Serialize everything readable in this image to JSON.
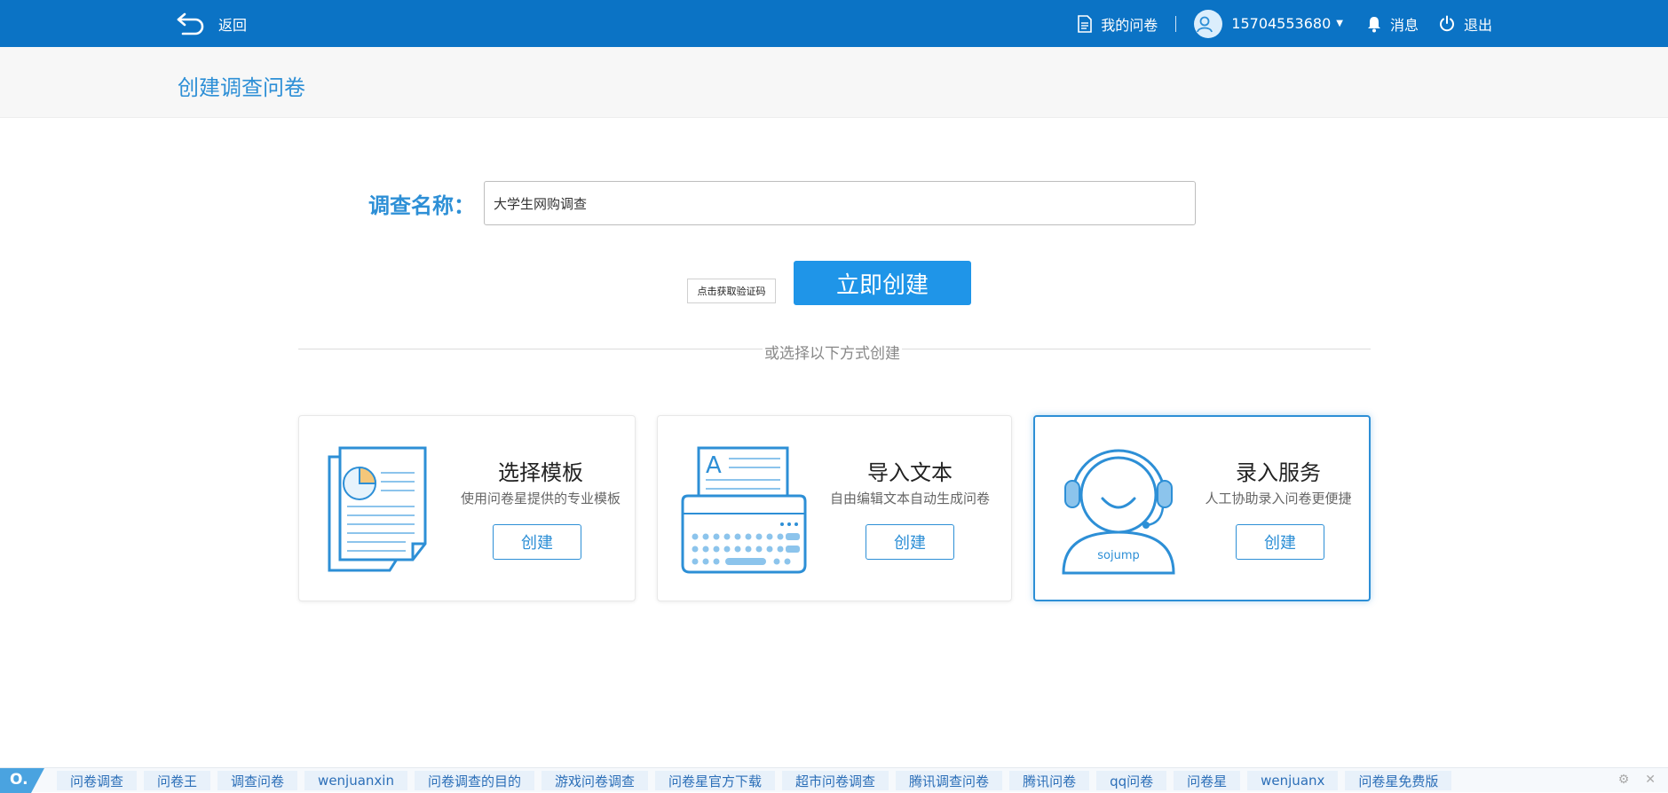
{
  "topbar": {
    "back_label": "返回",
    "my_surveys": "我的问卷",
    "phone": "15704553680",
    "messages": "消息",
    "logout": "退出"
  },
  "page_title": "创建调查问卷",
  "form": {
    "name_label": "调查名称：",
    "name_value": "大学生网购调查",
    "captcha_label": "点击获取验证码",
    "create_now": "立即创建"
  },
  "divider_text": "或选择以下方式创建",
  "cards": [
    {
      "title": "选择模板",
      "desc": "使用问卷星提供的专业模板",
      "button": "创建",
      "icon": "template-document-icon"
    },
    {
      "title": "导入文本",
      "desc": "自由编辑文本自动生成问卷",
      "button": "创建",
      "icon": "typewriter-icon"
    },
    {
      "title": "录入服务",
      "desc": "人工协助录入问卷更便捷",
      "button": "创建",
      "icon": "customer-service-icon",
      "logo_text": "sojump"
    }
  ],
  "bottom_links": [
    "问卷调查",
    "问卷王",
    "调查问卷",
    "wenjuanxin",
    "问卷调查的目的",
    "游戏问卷调查",
    "问卷星官方下载",
    "超市问卷调查",
    "腾讯调查问卷",
    "腾讯问卷",
    "qq问卷",
    "问卷星",
    "wenjuanx",
    "问卷星免费版"
  ],
  "colors": {
    "topbar": "#0b73c5",
    "accent": "#2d8fd6",
    "button": "#1f95e8"
  }
}
